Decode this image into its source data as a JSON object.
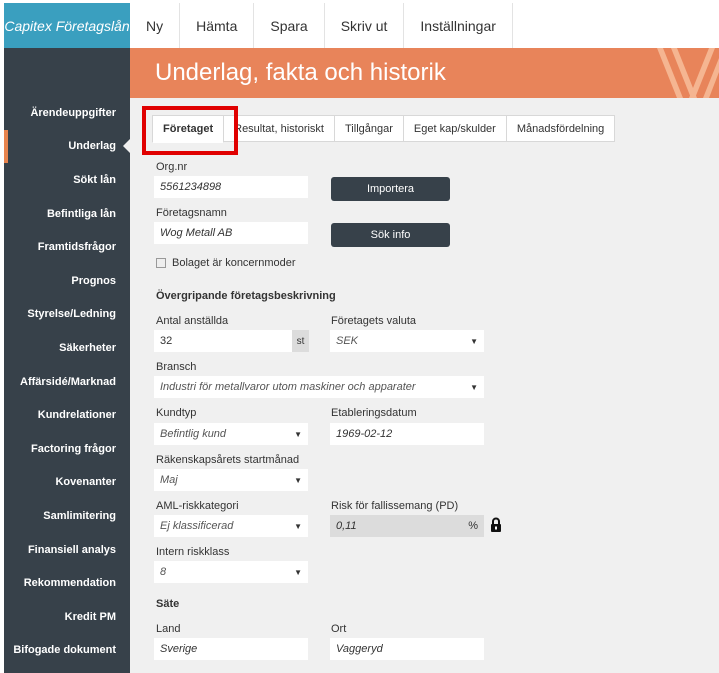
{
  "app": {
    "brand": "Capitex Företagslån"
  },
  "topnav": [
    "Ny",
    "Hämta",
    "Spara",
    "Skriv ut",
    "Inställningar"
  ],
  "sidebar": {
    "items": [
      "Ärendeuppgifter",
      "Underlag",
      "Sökt lån",
      "Befintliga lån",
      "Framtidsfrågor",
      "Prognos",
      "Styrelse/Ledning",
      "Säkerheter",
      "Affärsidé/Marknad",
      "Kundrelationer",
      "Factoring frågor",
      "Kovenanter",
      "Samlimitering",
      "Finansiell analys",
      "Rekommendation",
      "Kredit PM",
      "Bifogade dokument"
    ],
    "active": "Underlag"
  },
  "page": {
    "title": "Underlag, fakta och historik"
  },
  "tabs": [
    "Företaget",
    "Resultat, historiskt",
    "Tillgångar",
    "Eget kap/skulder",
    "Månadsfördelning"
  ],
  "form": {
    "orgnr_label": "Org.nr",
    "orgnr_value": "5561234898",
    "import_button": "Importera",
    "company_label": "Företagsnamn",
    "company_value": "Wog Metall AB",
    "search_button": "Sök info",
    "parent_checkbox_label": "Bolaget är koncernmoder",
    "section_overview": "Övergripande företagsbeskrivning",
    "employees_label": "Antal anställda",
    "employees_value": "32",
    "employees_unit": "st",
    "currency_label": "Företagets valuta",
    "currency_value": "SEK",
    "industry_label": "Bransch",
    "industry_value": "Industri för metallvaror utom maskiner och apparater",
    "customer_type_label": "Kundtyp",
    "customer_type_value": "Befintlig kund",
    "established_label": "Etableringsdatum",
    "established_value": "1969-02-12",
    "fiscal_start_label": "Räkenskapsårets startmånad",
    "fiscal_start_value": "Maj",
    "aml_label": "AML-riskkategori",
    "aml_value": "Ej klassificerad",
    "pd_label": "Risk för fallissemang (PD)",
    "pd_value": "0,11",
    "pd_unit": "%",
    "internal_risk_label": "Intern riskklass",
    "internal_risk_value": "8",
    "section_seat": "Säte",
    "country_label": "Land",
    "country_value": "Sverige",
    "city_label": "Ort",
    "city_value": "Vaggeryd"
  },
  "icons": {
    "lock": "lock-icon",
    "dropdown": "chevron-down-icon"
  },
  "colors": {
    "brand": "#3a9fbf",
    "sidebar": "#37414a",
    "header": "#e8845a",
    "highlight": "#e00000"
  }
}
